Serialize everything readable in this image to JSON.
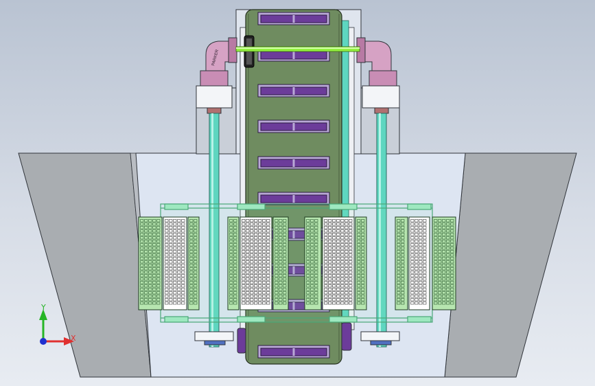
{
  "viewport": {
    "background": "#d3dae4"
  },
  "triad": {
    "x_label": "X",
    "y_label": "Y",
    "x_color": "#e03030",
    "y_color": "#26b526",
    "z_color": "#2030d0"
  },
  "model": {
    "base_left_face_color": "#a9acb0",
    "base_front_color": "#dfe6f2",
    "conveyor_color": "#6d8a5e",
    "slat_color": "#6c3c9a",
    "pipe_color": "#5ed6c0",
    "frame_color": "#6fd39a",
    "shaft_color": "#90f040",
    "elbow_color": "#c98db5",
    "elbow_label": "PARKER"
  }
}
